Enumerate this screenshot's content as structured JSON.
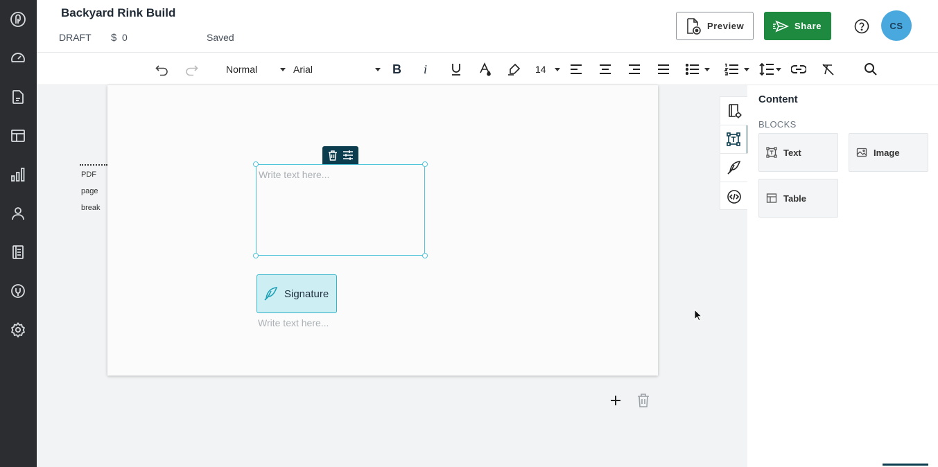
{
  "header": {
    "title": "Backyard Rink Build",
    "status": "DRAFT",
    "currency_symbol": "$",
    "amount": "0",
    "save_state": "Saved",
    "preview_label": "Preview",
    "share_label": "Share",
    "avatar_initials": "CS"
  },
  "left_rail": {
    "icons": [
      "logo-icon",
      "dashboard-icon",
      "documents-icon",
      "templates-icon",
      "analytics-icon",
      "contacts-icon",
      "catalog-icon",
      "integrations-icon",
      "settings-icon"
    ]
  },
  "toolbar": {
    "style_value": "Normal",
    "font_value": "Arial",
    "font_size_value": "14"
  },
  "editor": {
    "pdf_break_label": [
      "PDF",
      "page",
      "break"
    ],
    "text_block_placeholder": "Write text here...",
    "signature_label": "Signature",
    "signature_text_placeholder": "Write text here..."
  },
  "panel": {
    "title": "Content",
    "section_label": "BLOCKS",
    "blocks": [
      {
        "label": "Text",
        "icon": "text-block-icon"
      },
      {
        "label": "Image",
        "icon": "image-block-icon"
      },
      {
        "label": "Table",
        "icon": "table-block-icon"
      }
    ]
  },
  "colors": {
    "rail_bg": "#2b2d30",
    "share_green": "#1d8a3f",
    "avatar_blue": "#49a9de",
    "selection_teal": "#4fc4d8",
    "signature_bg": "#cdeff4",
    "dark_accent": "#0b3d4f"
  }
}
